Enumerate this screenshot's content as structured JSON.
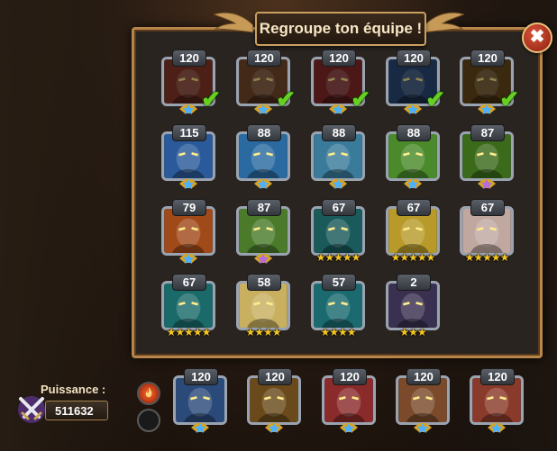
{
  "title": "Regroupe ton équipe !",
  "close_icon": "close-icon",
  "power": {
    "label": "Puissance :",
    "value": "511632",
    "icon": "crossed-swords-icon"
  },
  "colors": {
    "accent": "#b8864a",
    "check": "#66d022",
    "star": "#f5c623"
  },
  "roster": [
    {
      "level": "120",
      "stars": "",
      "emblem": "blue",
      "selected": true,
      "color": "#8a3a2a"
    },
    {
      "level": "120",
      "stars": "",
      "emblem": "blue",
      "selected": true,
      "color": "#7a4a2a"
    },
    {
      "level": "120",
      "stars": "",
      "emblem": "blue",
      "selected": true,
      "color": "#8a2a2a"
    },
    {
      "level": "120",
      "stars": "",
      "emblem": "blue",
      "selected": true,
      "color": "#2a4a7a"
    },
    {
      "level": "120",
      "stars": "",
      "emblem": "blue",
      "selected": true,
      "color": "#6a4a1a"
    },
    {
      "level": "115",
      "stars": "",
      "emblem": "blue",
      "selected": false,
      "color": "#2a5a9a"
    },
    {
      "level": "88",
      "stars": "",
      "emblem": "blue",
      "selected": false,
      "color": "#2a6aa0"
    },
    {
      "level": "88",
      "stars": "",
      "emblem": "blue",
      "selected": false,
      "color": "#3a7a9a"
    },
    {
      "level": "88",
      "stars": "",
      "emblem": "blue",
      "selected": false,
      "color": "#4a8a2a"
    },
    {
      "level": "87",
      "stars": "",
      "emblem": "purple",
      "selected": false,
      "color": "#3a6a1a"
    },
    {
      "level": "79",
      "stars": "",
      "emblem": "blue",
      "selected": false,
      "color": "#a04a1a"
    },
    {
      "level": "87",
      "stars": "",
      "emblem": "purple",
      "selected": false,
      "color": "#4a7a2a"
    },
    {
      "level": "67",
      "stars": "★★★★★",
      "emblem": "",
      "selected": false,
      "color": "#1a5a5a"
    },
    {
      "level": "67",
      "stars": "★★★★★",
      "emblem": "",
      "selected": false,
      "color": "#b89a2a"
    },
    {
      "level": "67",
      "stars": "★★★★★",
      "emblem": "",
      "selected": false,
      "color": "#c0a8a0"
    },
    {
      "level": "67",
      "stars": "★★★★★",
      "emblem": "",
      "selected": false,
      "color": "#1a6a6a"
    },
    {
      "level": "58",
      "stars": "★★★★",
      "emblem": "",
      "selected": false,
      "color": "#c8b060"
    },
    {
      "level": "57",
      "stars": "★★★★",
      "emblem": "",
      "selected": false,
      "color": "#1a6a70"
    },
    {
      "level": "2",
      "stars": "★★★",
      "emblem": "",
      "selected": false,
      "color": "#3a3050"
    }
  ],
  "team": [
    {
      "level": "120",
      "emblem": "blue",
      "color": "#2a4a7a"
    },
    {
      "level": "120",
      "emblem": "blue",
      "color": "#6a4a1a"
    },
    {
      "level": "120",
      "emblem": "blue",
      "color": "#8a2a2a"
    },
    {
      "level": "120",
      "emblem": "blue",
      "color": "#7a4a2a"
    },
    {
      "level": "120",
      "emblem": "blue",
      "color": "#8a3a2a"
    }
  ]
}
